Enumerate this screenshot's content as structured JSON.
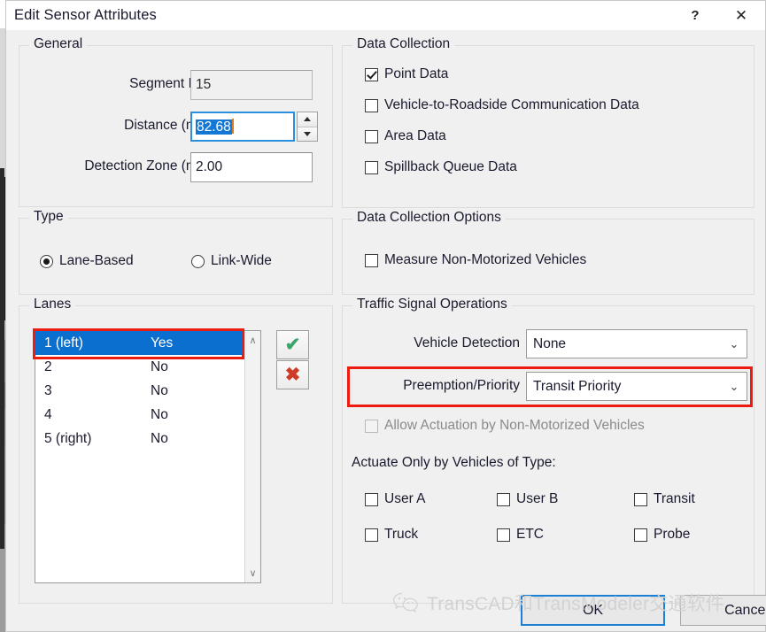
{
  "window": {
    "title": "Edit Sensor Attributes",
    "help_label": "?",
    "close_label": "✕"
  },
  "general": {
    "legend": "General",
    "segment_id_label": "Segment ID",
    "segment_id_value": "15",
    "distance_label": "Distance (m)",
    "distance_value": "82.68",
    "detection_zone_label": "Detection Zone (m)",
    "detection_zone_value": "2.00"
  },
  "type": {
    "legend": "Type",
    "options": [
      {
        "label": "Lane-Based",
        "selected": true
      },
      {
        "label": "Link-Wide",
        "selected": false
      }
    ]
  },
  "lanes": {
    "legend": "Lanes",
    "rows": [
      {
        "name": "1 (left)",
        "value": "Yes",
        "selected": true
      },
      {
        "name": "2",
        "value": "No",
        "selected": false
      },
      {
        "name": "3",
        "value": "No",
        "selected": false
      },
      {
        "name": "4",
        "value": "No",
        "selected": false
      },
      {
        "name": "5 (right)",
        "value": "No",
        "selected": false
      }
    ],
    "accept_label": "✔",
    "delete_label": "✖",
    "scroll_up": "∧",
    "scroll_down": "∨"
  },
  "data_collection": {
    "legend": "Data Collection",
    "items": [
      {
        "label": "Point Data",
        "checked": true
      },
      {
        "label": "Vehicle-to-Roadside Communication Data",
        "checked": false
      },
      {
        "label": "Area Data",
        "checked": false
      },
      {
        "label": "Spillback Queue Data",
        "checked": false
      }
    ]
  },
  "data_collection_options": {
    "legend": "Data Collection Options",
    "items": [
      {
        "label": "Measure Non-Motorized Vehicles",
        "checked": false
      }
    ]
  },
  "traffic_signal_operations": {
    "legend": "Traffic Signal Operations",
    "vehicle_detection_label": "Vehicle Detection",
    "vehicle_detection_value": "None",
    "preemption_label": "Preemption/Priority",
    "preemption_value": "Transit Priority",
    "allow_actuation_label": "Allow Actuation by Non-Motorized Vehicles",
    "allow_actuation_checked": false,
    "allow_actuation_disabled": true,
    "actuate_heading": "Actuate Only by Vehicles of Type:",
    "vehicle_types": [
      {
        "label": "User A",
        "checked": false
      },
      {
        "label": "User B",
        "checked": false
      },
      {
        "label": "Transit",
        "checked": false
      },
      {
        "label": "Truck",
        "checked": false
      },
      {
        "label": "ETC",
        "checked": false
      },
      {
        "label": "Probe",
        "checked": false
      }
    ],
    "dropdown_arrow": "⌄"
  },
  "footer": {
    "ok_label": "OK",
    "cancel_label": "Cancel"
  },
  "watermark": {
    "text": "TransCAD和TransModeler交通软件"
  },
  "colors": {
    "highlight_red": "#ee1c10",
    "selection_blue": "#0b6fd0",
    "focus_blue": "#2a8fdd",
    "accept_green": "#3aa569",
    "delete_red": "#cf3b27"
  }
}
